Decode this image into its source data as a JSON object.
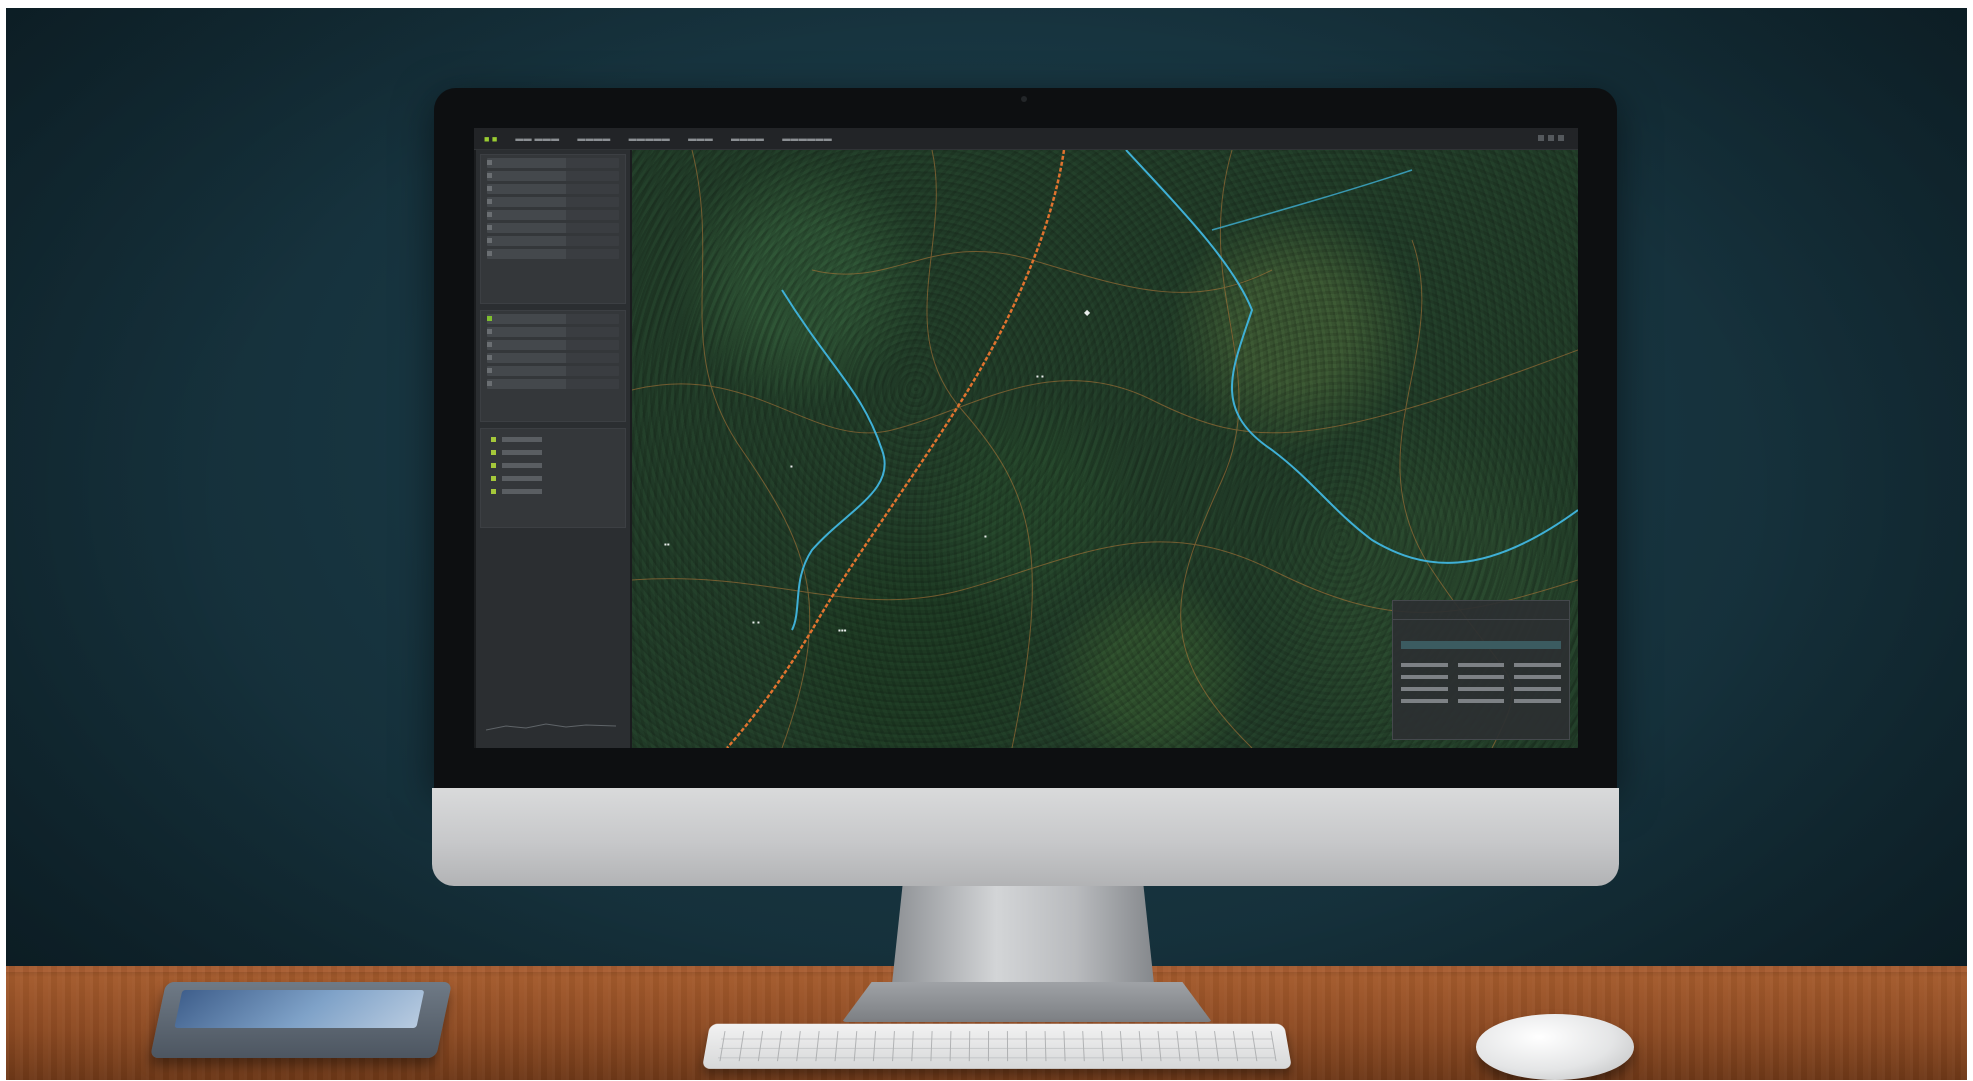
{
  "scene": {
    "description_free": true,
    "wall_color": "#17343f",
    "desk_color": "#9a542a"
  },
  "monitor": {
    "screen_app": {
      "map_colors": {
        "forest": "#23402a",
        "river": "#3fb0d6",
        "road": "#e0732f",
        "trail": "#b97a3a"
      },
      "accent": "#9acd32"
    }
  },
  "icons": {
    "app_logo": "app-logo-icon",
    "window_controls": "window-control-icon",
    "legend_swatch": "legend-swatch-icon"
  }
}
